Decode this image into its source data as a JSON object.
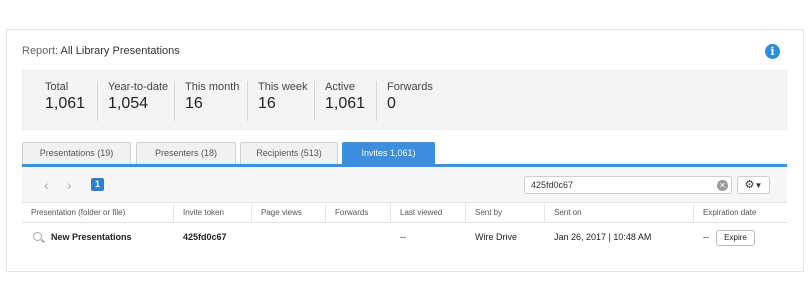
{
  "report": {
    "prefix": "Report:",
    "title": "All Library Presentations"
  },
  "stats": [
    {
      "label": "Total",
      "value": "1,061"
    },
    {
      "label": "Year-to-date",
      "value": "1,054"
    },
    {
      "label": "This month",
      "value": "16"
    },
    {
      "label": "This week",
      "value": "16"
    },
    {
      "label": "Active",
      "value": "1,061"
    },
    {
      "label": "Forwards",
      "value": "0"
    }
  ],
  "tabs": [
    {
      "label": "Presentations (19)"
    },
    {
      "label": "Presenters (18)"
    },
    {
      "label": "Recipients (513)"
    },
    {
      "label": "Invites 1,061)"
    }
  ],
  "toolbar": {
    "page": "1",
    "search_value": "425fd0c67"
  },
  "table": {
    "headers": [
      "Presentation (folder or file)",
      "Invite token",
      "Page views",
      "Forwards",
      "Last viewed",
      "Sent by",
      "Sent on",
      "Expiration date"
    ],
    "rows": [
      {
        "presentation": "New Presentations",
        "token": "425fd0c67",
        "page_views": "",
        "forwards": "",
        "last_viewed": "--",
        "sent_by": "Wire Drive",
        "sent_on": "Jan 26, 2017 | 10:48 AM",
        "expiration": "--",
        "action": "Expire"
      }
    ]
  },
  "icons": {
    "info": "info-icon",
    "gear": "gear-icon",
    "clear": "clear-icon",
    "search": "search-icon"
  },
  "colors": {
    "accent": "#3c8fe0",
    "badge": "#2e7fcc"
  }
}
